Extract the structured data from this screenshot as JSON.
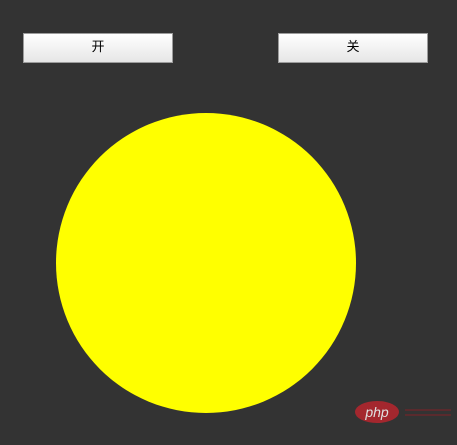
{
  "buttons": {
    "on_label": "开",
    "off_label": "关"
  },
  "bulb": {
    "state": "on",
    "color": "#ffff00"
  },
  "watermark": {
    "text": "php",
    "color": "#b8252e"
  },
  "colors": {
    "background": "#333333"
  }
}
